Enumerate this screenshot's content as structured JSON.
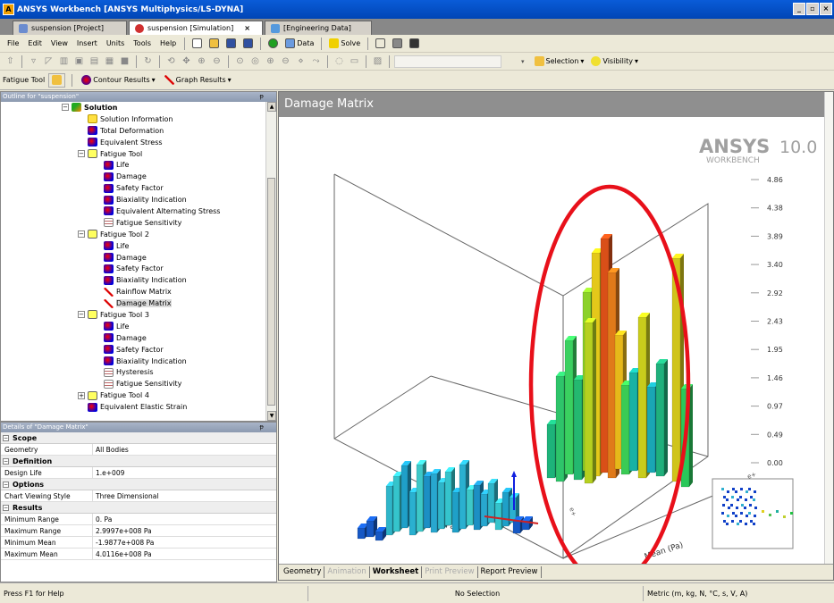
{
  "window": {
    "title": "ANSYS Workbench [ANSYS Multiphysics/LS-DYNA]"
  },
  "tabs": [
    {
      "label": "suspension [Project]",
      "icon": "project-icon"
    },
    {
      "label": "suspension [Simulation]",
      "icon": "simulation-icon",
      "close": "×"
    },
    {
      "label": "[Engineering Data]",
      "icon": "engineering-data-icon"
    }
  ],
  "menu": [
    "File",
    "Edit",
    "View",
    "Insert",
    "Units",
    "Tools",
    "Help"
  ],
  "toolbar": {
    "data_label": "Data",
    "solve_label": "Solve",
    "selection_label": "Selection",
    "visibility_label": "Visibility"
  },
  "context_toolbar": {
    "tool_label": "Fatigue Tool",
    "contour_label": "Contour Results",
    "graph_label": "Graph Results"
  },
  "outline": {
    "title": "Outline for \"suspension\"",
    "items": [
      {
        "label": "Solution",
        "icon": "solution",
        "bold": true,
        "exp": "−"
      },
      {
        "label": "Solution Information",
        "icon": "info"
      },
      {
        "label": "Total Deformation",
        "icon": "result"
      },
      {
        "label": "Equivalent Stress",
        "icon": "result"
      },
      {
        "label": "Fatigue Tool",
        "icon": "tool",
        "exp": "−"
      },
      {
        "label": "Life",
        "icon": "result"
      },
      {
        "label": "Damage",
        "icon": "result"
      },
      {
        "label": "Safety Factor",
        "icon": "result"
      },
      {
        "label": "Biaxiality Indication",
        "icon": "result"
      },
      {
        "label": "Equivalent Alternating Stress",
        "icon": "result"
      },
      {
        "label": "Fatigue Sensitivity",
        "icon": "sens"
      },
      {
        "label": "Fatigue Tool 2",
        "icon": "tool",
        "exp": "−"
      },
      {
        "label": "Life",
        "icon": "result"
      },
      {
        "label": "Damage",
        "icon": "result"
      },
      {
        "label": "Safety Factor",
        "icon": "result"
      },
      {
        "label": "Biaxiality Indication",
        "icon": "result"
      },
      {
        "label": "Rainflow Matrix",
        "icon": "matrix"
      },
      {
        "label": "Damage Matrix",
        "icon": "matrix",
        "selected": true
      },
      {
        "label": "Fatigue Tool 3",
        "icon": "tool",
        "exp": "−"
      },
      {
        "label": "Life",
        "icon": "result"
      },
      {
        "label": "Damage",
        "icon": "result"
      },
      {
        "label": "Safety Factor",
        "icon": "result"
      },
      {
        "label": "Biaxiality Indication",
        "icon": "result"
      },
      {
        "label": "Hysteresis",
        "icon": "sens"
      },
      {
        "label": "Fatigue Sensitivity",
        "icon": "sens"
      },
      {
        "label": "Fatigue Tool 4",
        "icon": "tool",
        "exp": "+"
      },
      {
        "label": "Equivalent Elastic Strain",
        "icon": "result"
      }
    ]
  },
  "details": {
    "title": "Details of \"Damage Matrix\"",
    "sections": [
      {
        "name": "Scope",
        "rows": [
          {
            "k": "Geometry",
            "v": "All Bodies"
          }
        ]
      },
      {
        "name": "Definition",
        "rows": [
          {
            "k": "Design Life",
            "v": "1.e+009"
          }
        ]
      },
      {
        "name": "Options",
        "rows": [
          {
            "k": "Chart Viewing Style",
            "v": "Three Dimensional"
          }
        ]
      },
      {
        "name": "Results",
        "rows": [
          {
            "k": "Minimum Range",
            "v": "0. Pa"
          },
          {
            "k": "Maximum Range",
            "v": "2.9997e+008 Pa"
          },
          {
            "k": "Minimum Mean",
            "v": "-1.9877e+008 Pa"
          },
          {
            "k": "Maximum Mean",
            "v": "4.0116e+008 Pa"
          }
        ]
      }
    ]
  },
  "graph": {
    "title": "Damage Matrix",
    "logo_main": "ANSYS",
    "logo_version": "10.0",
    "logo_sub": "WORKBENCH",
    "legend_values": [
      "4.86",
      "4.38",
      "3.89",
      "3.40",
      "2.92",
      "2.43",
      "1.95",
      "1.46",
      "0.97",
      "0.49",
      "0.00"
    ],
    "axis_range": "Range (Pa)",
    "axis_mean": "Mean (Pa)",
    "axis_small": "e+"
  },
  "bottom_tabs": [
    {
      "label": "Geometry",
      "state": "normal"
    },
    {
      "label": "Animation",
      "state": "disabled"
    },
    {
      "label": "Worksheet",
      "state": "active"
    },
    {
      "label": "Print Preview",
      "state": "disabled"
    },
    {
      "label": "Report Preview",
      "state": "normal"
    }
  ],
  "status": {
    "help": "Press F1 for Help",
    "selection": "No Selection",
    "units": "Metric (m, kg, N, °C, s, V, A)"
  },
  "colors": {
    "annotation": "#e8101a",
    "title_bar": "#0a5cd8",
    "graph_header": "#8f8f8f"
  }
}
